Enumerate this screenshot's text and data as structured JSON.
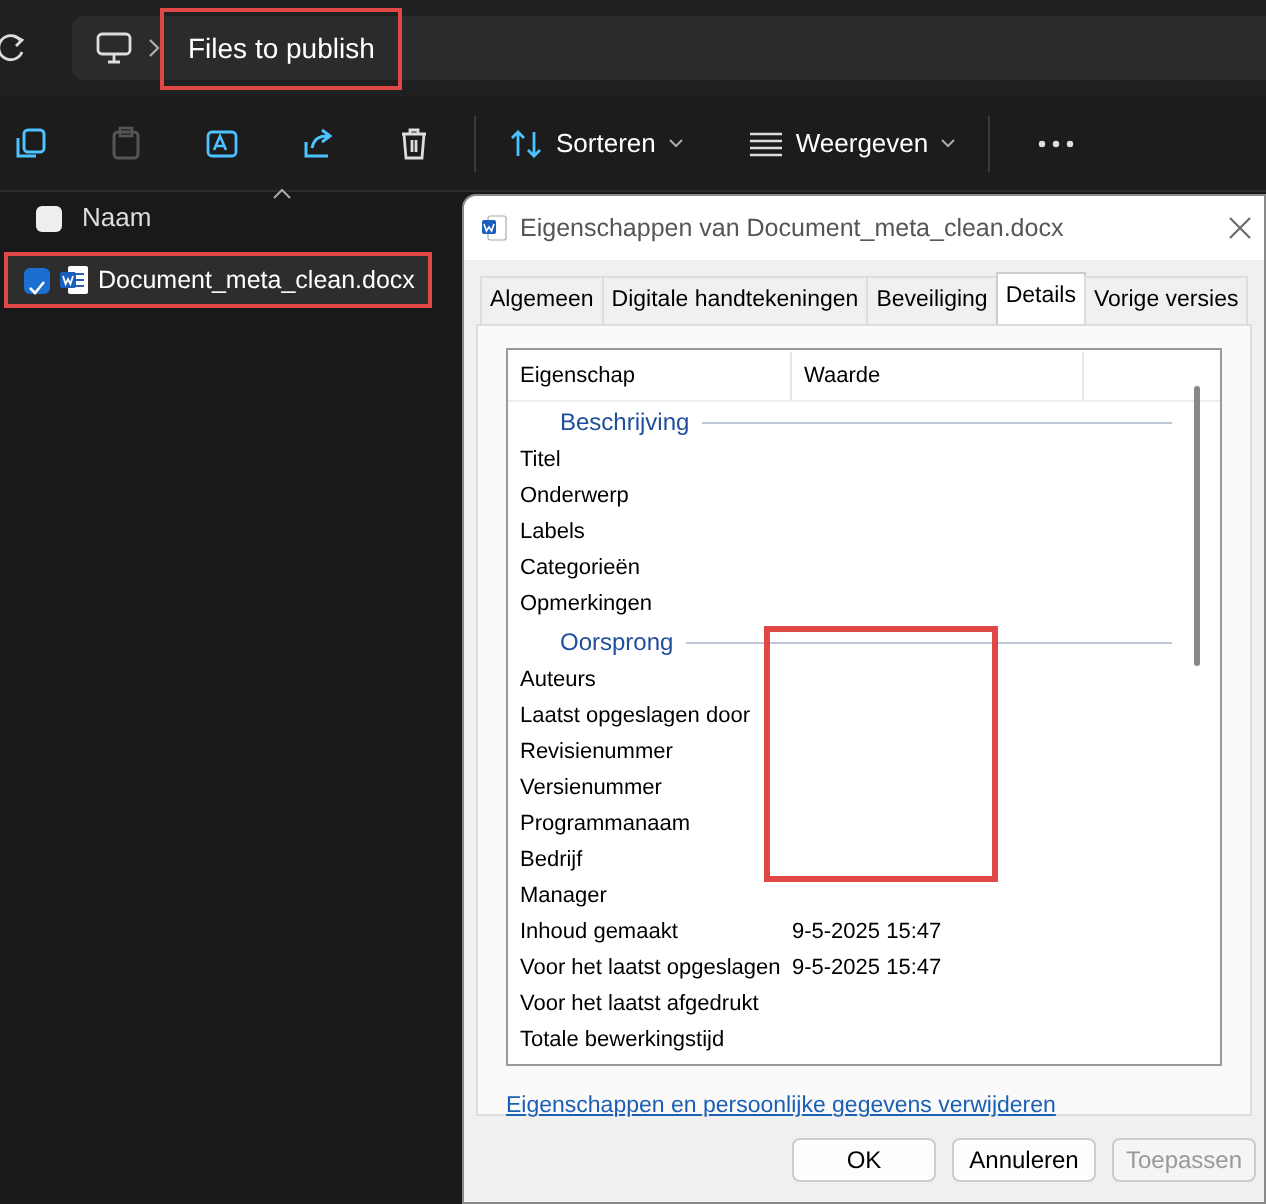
{
  "breadcrumb": {
    "label": "Files to publish",
    "highlighted": true
  },
  "toolbar": {
    "sort_label": "Sorteren",
    "view_label": "Weergeven"
  },
  "file_list": {
    "column": "Naam",
    "all_checked": false,
    "files": [
      {
        "name": "Document_meta_clean.docx",
        "checked": true,
        "selected": true,
        "highlighted": true
      }
    ]
  },
  "dialog": {
    "title": "Eigenschappen van Document_meta_clean.docx",
    "tabs": [
      {
        "label": "Algemeen",
        "selected": false
      },
      {
        "label": "Digitale handtekeningen",
        "selected": false
      },
      {
        "label": "Beveiliging",
        "selected": false
      },
      {
        "label": "Details",
        "selected": true
      },
      {
        "label": "Vorige versies",
        "selected": false
      }
    ],
    "columns": [
      "Eigenschap",
      "Waarde"
    ],
    "groups": [
      {
        "heading": "Beschrijving",
        "value_highlight": false,
        "properties": [
          {
            "name": "Titel"
          },
          {
            "name": "Onderwerp"
          },
          {
            "name": "Labels"
          },
          {
            "name": "Categorieën"
          },
          {
            "name": "Opmerkingen"
          }
        ]
      },
      {
        "heading": "Oorsprong",
        "value_highlight": true,
        "properties": [
          {
            "name": "Auteurs"
          },
          {
            "name": "Laatst opgeslagen door"
          },
          {
            "name": "Revisienummer"
          },
          {
            "name": "Versienummer"
          },
          {
            "name": "Programmanaam"
          },
          {
            "name": "Bedrijf"
          },
          {
            "name": "Manager"
          },
          {
            "name": "Inhoud gemaakt",
            "value": "9-5-2025 15:47"
          },
          {
            "name": "Voor het laatst opgeslagen",
            "value": "9-5-2025 15:47"
          },
          {
            "name": "Voor het laatst afgedrukt"
          },
          {
            "name": "Totale bewerkingstijd"
          }
        ]
      }
    ],
    "link": "Eigenschappen en persoonlijke gegevens verwijderen",
    "buttons": [
      {
        "label": "OK",
        "disabled": false
      },
      {
        "label": "Annuleren",
        "disabled": false
      },
      {
        "label": "Toepassen",
        "disabled": true
      }
    ]
  }
}
